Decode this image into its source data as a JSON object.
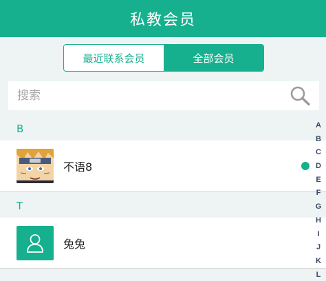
{
  "header": {
    "title": "私教会员"
  },
  "tabs": [
    {
      "label": "最近联系会员",
      "active": false
    },
    {
      "label": "全部会员",
      "active": true
    }
  ],
  "search": {
    "placeholder": "搜索",
    "icon": "search-icon"
  },
  "sections": [
    {
      "letter": "B",
      "members": [
        {
          "name": "不语8",
          "avatar": "anime-photo",
          "unread": true
        }
      ]
    },
    {
      "letter": "T",
      "members": [
        {
          "name": "兔兔",
          "avatar": "default-user-icon",
          "unread": false
        }
      ]
    }
  ],
  "index_letters": [
    "A",
    "B",
    "C",
    "D",
    "E",
    "F",
    "G",
    "H",
    "I",
    "J",
    "K",
    "L"
  ],
  "colors": {
    "accent": "#17b08e",
    "background": "#eef4f4",
    "index_text": "#3a4a66"
  }
}
